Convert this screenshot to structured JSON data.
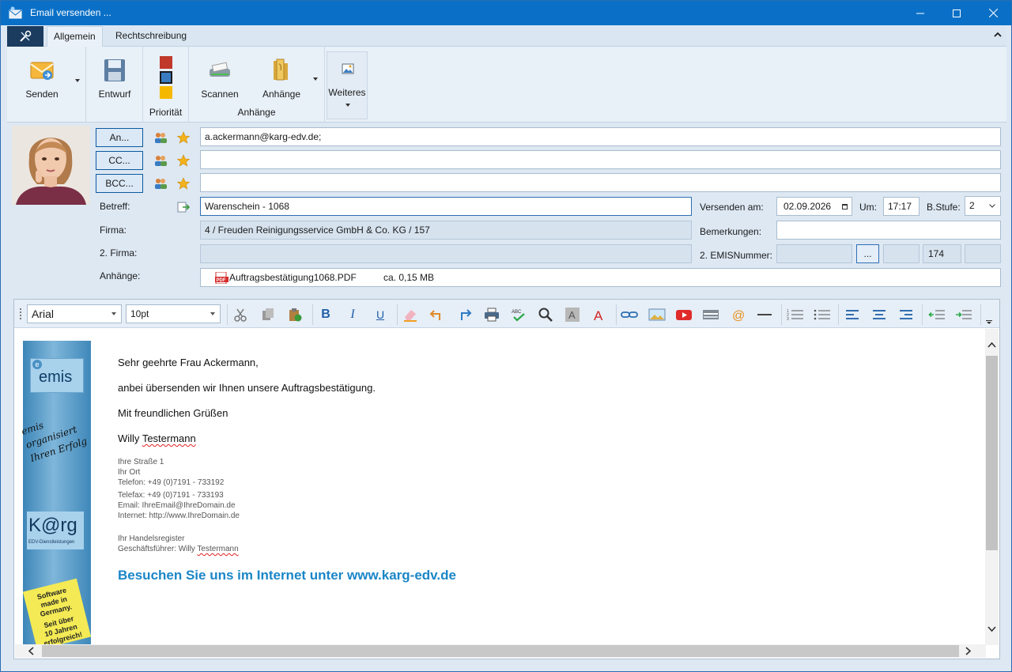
{
  "window": {
    "title": "Email versenden ...",
    "icon": "email-app-icon"
  },
  "ribbon": {
    "tabs": [
      {
        "label": "Allgemein",
        "active": true
      },
      {
        "label": "Rechtschreibung",
        "active": false
      }
    ],
    "send_label": "Senden",
    "draft_label": "Entwurf",
    "priority_label": "Priorität",
    "priority_colors": [
      "#c0392b",
      "#3a7cc2",
      "#f5b800"
    ],
    "scan_label": "Scannen",
    "attachments_label": "Anhänge",
    "attachments_group_label": "Anhänge",
    "more_label": "Weiteres"
  },
  "header": {
    "to_button": "An...",
    "cc_button": "CC...",
    "bcc_button": "BCC...",
    "to_value": "a.ackermann@karg-edv.de;",
    "cc_value": "",
    "bcc_value": "",
    "subject_label": "Betreff:",
    "subject_value": "Warenschein - 1068",
    "company_label": "Firma:",
    "company_value": "4 / Freuden Reinigungsservice GmbH & Co. KG / 157",
    "company2_label": "2. Firma:",
    "company2_value": "",
    "attachments_label": "Anhänge:",
    "attachment_file": "Auftragsbestätigung1068.PDF",
    "attachment_size": "ca. 0,15 MB",
    "send_on_label": "Versenden am:",
    "send_on_value": "02.09.2026",
    "time_label": "Um:",
    "time_value": "17:17",
    "bstufe_label": "B.Stufe:",
    "bstufe_value": "2",
    "remarks_label": "Bemerkungen:",
    "remarks_value": "",
    "emis_label": "2. EMISNummer:",
    "emis_button": "...",
    "emis_number": "174"
  },
  "editor": {
    "font": "Arial",
    "size": "10pt",
    "body": {
      "greeting": "Sehr geehrte Frau Ackermann,",
      "line1": "anbei übersenden wir Ihnen unsere Auftragsbestätigung.",
      "closing": "Mit freundlichen Grüßen",
      "signer_first": "Willy",
      "signer_last": "Testermann",
      "street": "Ihre Straße 1",
      "city": "Ihr Ort",
      "phone": "Telefon: +49 (0)7191 - 733192",
      "fax": "Telefax: +49 (0)7191 - 733193",
      "email": "Email:  IhreEmail@IhreDomain.de",
      "internet": "Internet: http://www.IhreDomain.de",
      "register": "Ihr Handelsregister",
      "ceo_prefix": "Geschäftsführer: Willy",
      "ceo_last": "Testermann",
      "website_line": "Besuchen Sie uns im Internet unter www.karg-edv.de"
    },
    "banner": {
      "logo1": "emis",
      "handwriting1": "emis",
      "handwriting2": "organisiert",
      "handwriting3": "Ihren Erfolg",
      "logo2": "K@rg",
      "logo2_sub": "EDV-Dienstleistungen",
      "sticker1": "Software",
      "sticker2": "made in",
      "sticker3": "Germany.",
      "sticker4": "Seit über",
      "sticker5": "10 Jahren",
      "sticker6": "erfolgreich!"
    }
  }
}
